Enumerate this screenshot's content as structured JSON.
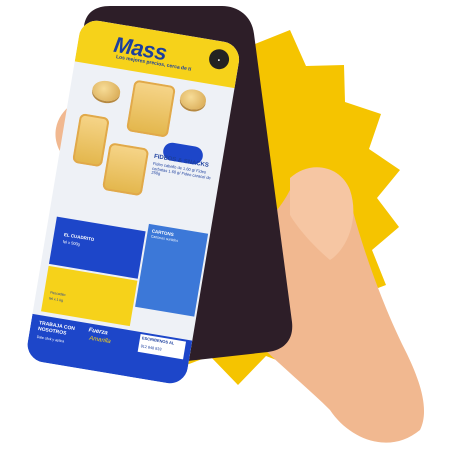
{
  "app": {
    "brand": "Mass",
    "tagline": "Los mejores precios, cerca de ti"
  },
  "promo": {
    "title": "FIDEOS & SNACKS",
    "desc": "Fideo cabello de 1.60 g/ Fideo corbatas 1.60 g/ Fideo caracol de 250g"
  },
  "panel_left": {
    "title": "EL CUADRITO",
    "subtitle": "fel x 500g"
  },
  "panel_right": {
    "title": "CARTONS",
    "subtitle": "Cartones surtidos"
  },
  "panel_yellow": {
    "label": "Pescadito",
    "subtitle": "fel x 1 kg"
  },
  "cta": {
    "left_title": "TRABAJA CON NOSOTROS",
    "left_sub": "Dale click y aplica",
    "center_title": "Fuerza",
    "center_sub": "Amarilla",
    "right_title": "ESCRIBENOS AL",
    "right_phone": "912 848 833"
  },
  "colors": {
    "brand_yellow": "#f6d21a",
    "brand_blue": "#1d46c9",
    "skin": "#f1b890"
  }
}
